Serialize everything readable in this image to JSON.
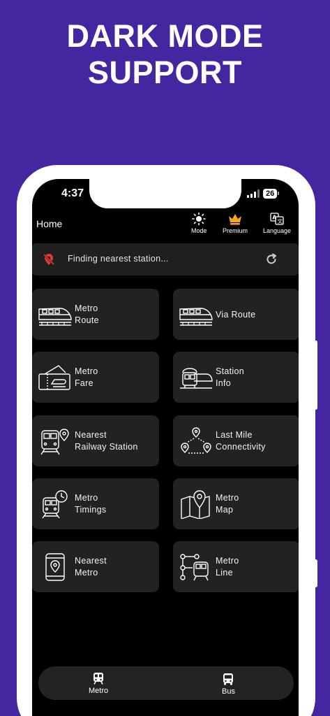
{
  "promo": {
    "line1": "DARK MODE",
    "line2": "SUPPORT"
  },
  "status_bar": {
    "time": "4:37",
    "battery": "26"
  },
  "header": {
    "title": "Home",
    "actions": [
      {
        "label": "Mode",
        "icon": "sun-icon"
      },
      {
        "label": "Premium",
        "icon": "crown-icon",
        "color": "#f5a623"
      },
      {
        "label": "Language",
        "icon": "translate-icon"
      }
    ]
  },
  "location": {
    "text": "Finding nearest station...",
    "icon": "location-off-icon",
    "icon_color": "#e53935"
  },
  "cards": [
    {
      "line1": "Metro",
      "line2": "Route",
      "icon": "metro-train-icon"
    },
    {
      "line1": "Via Route",
      "line2": "",
      "icon": "metro-train-icon"
    },
    {
      "line1": "Metro",
      "line2": "Fare",
      "icon": "ticket-icon"
    },
    {
      "line1": "Station",
      "line2": "Info",
      "icon": "station-icon"
    },
    {
      "line1": "Nearest",
      "line2": "Railway Station",
      "icon": "railway-station-icon"
    },
    {
      "line1": "Last Mile",
      "line2": "Connectivity",
      "icon": "route-pins-icon"
    },
    {
      "line1": "Metro",
      "line2": "Timings",
      "icon": "train-clock-icon"
    },
    {
      "line1": "Metro",
      "line2": "Map",
      "icon": "map-pin-icon"
    },
    {
      "line1": "Nearest",
      "line2": "Metro",
      "icon": "phone-location-icon"
    },
    {
      "line1": "Metro",
      "line2": "Line",
      "icon": "metro-line-icon"
    }
  ],
  "bottom_nav": [
    {
      "label": "Metro",
      "icon": "train-icon",
      "active": true
    },
    {
      "label": "Bus",
      "icon": "bus-icon",
      "active": false
    }
  ],
  "colors": {
    "background": "#4427a0",
    "screen": "#000000",
    "card": "#222222",
    "accent": "#f5a623"
  }
}
